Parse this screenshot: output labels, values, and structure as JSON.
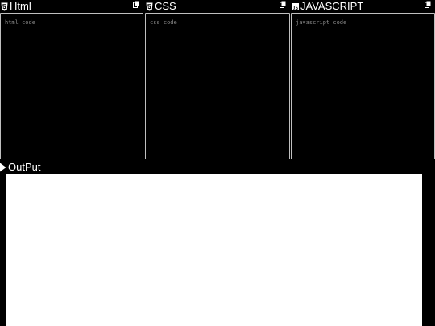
{
  "editors": {
    "html": {
      "title": "Html",
      "placeholder": "html code",
      "icon": "html5-icon"
    },
    "css": {
      "title": "CSS",
      "placeholder": "css code",
      "icon": "css3-icon"
    },
    "js": {
      "title": "JAVASCRIPT",
      "placeholder": "javascript code",
      "icon": "js-icon"
    }
  },
  "output": {
    "title": "OutPut",
    "icon": "play-icon"
  },
  "colors": {
    "background": "#000000",
    "text": "#ffffff",
    "border": "#bfbfbf",
    "placeholder": "#8a8a8a",
    "output_bg": "#ffffff"
  }
}
